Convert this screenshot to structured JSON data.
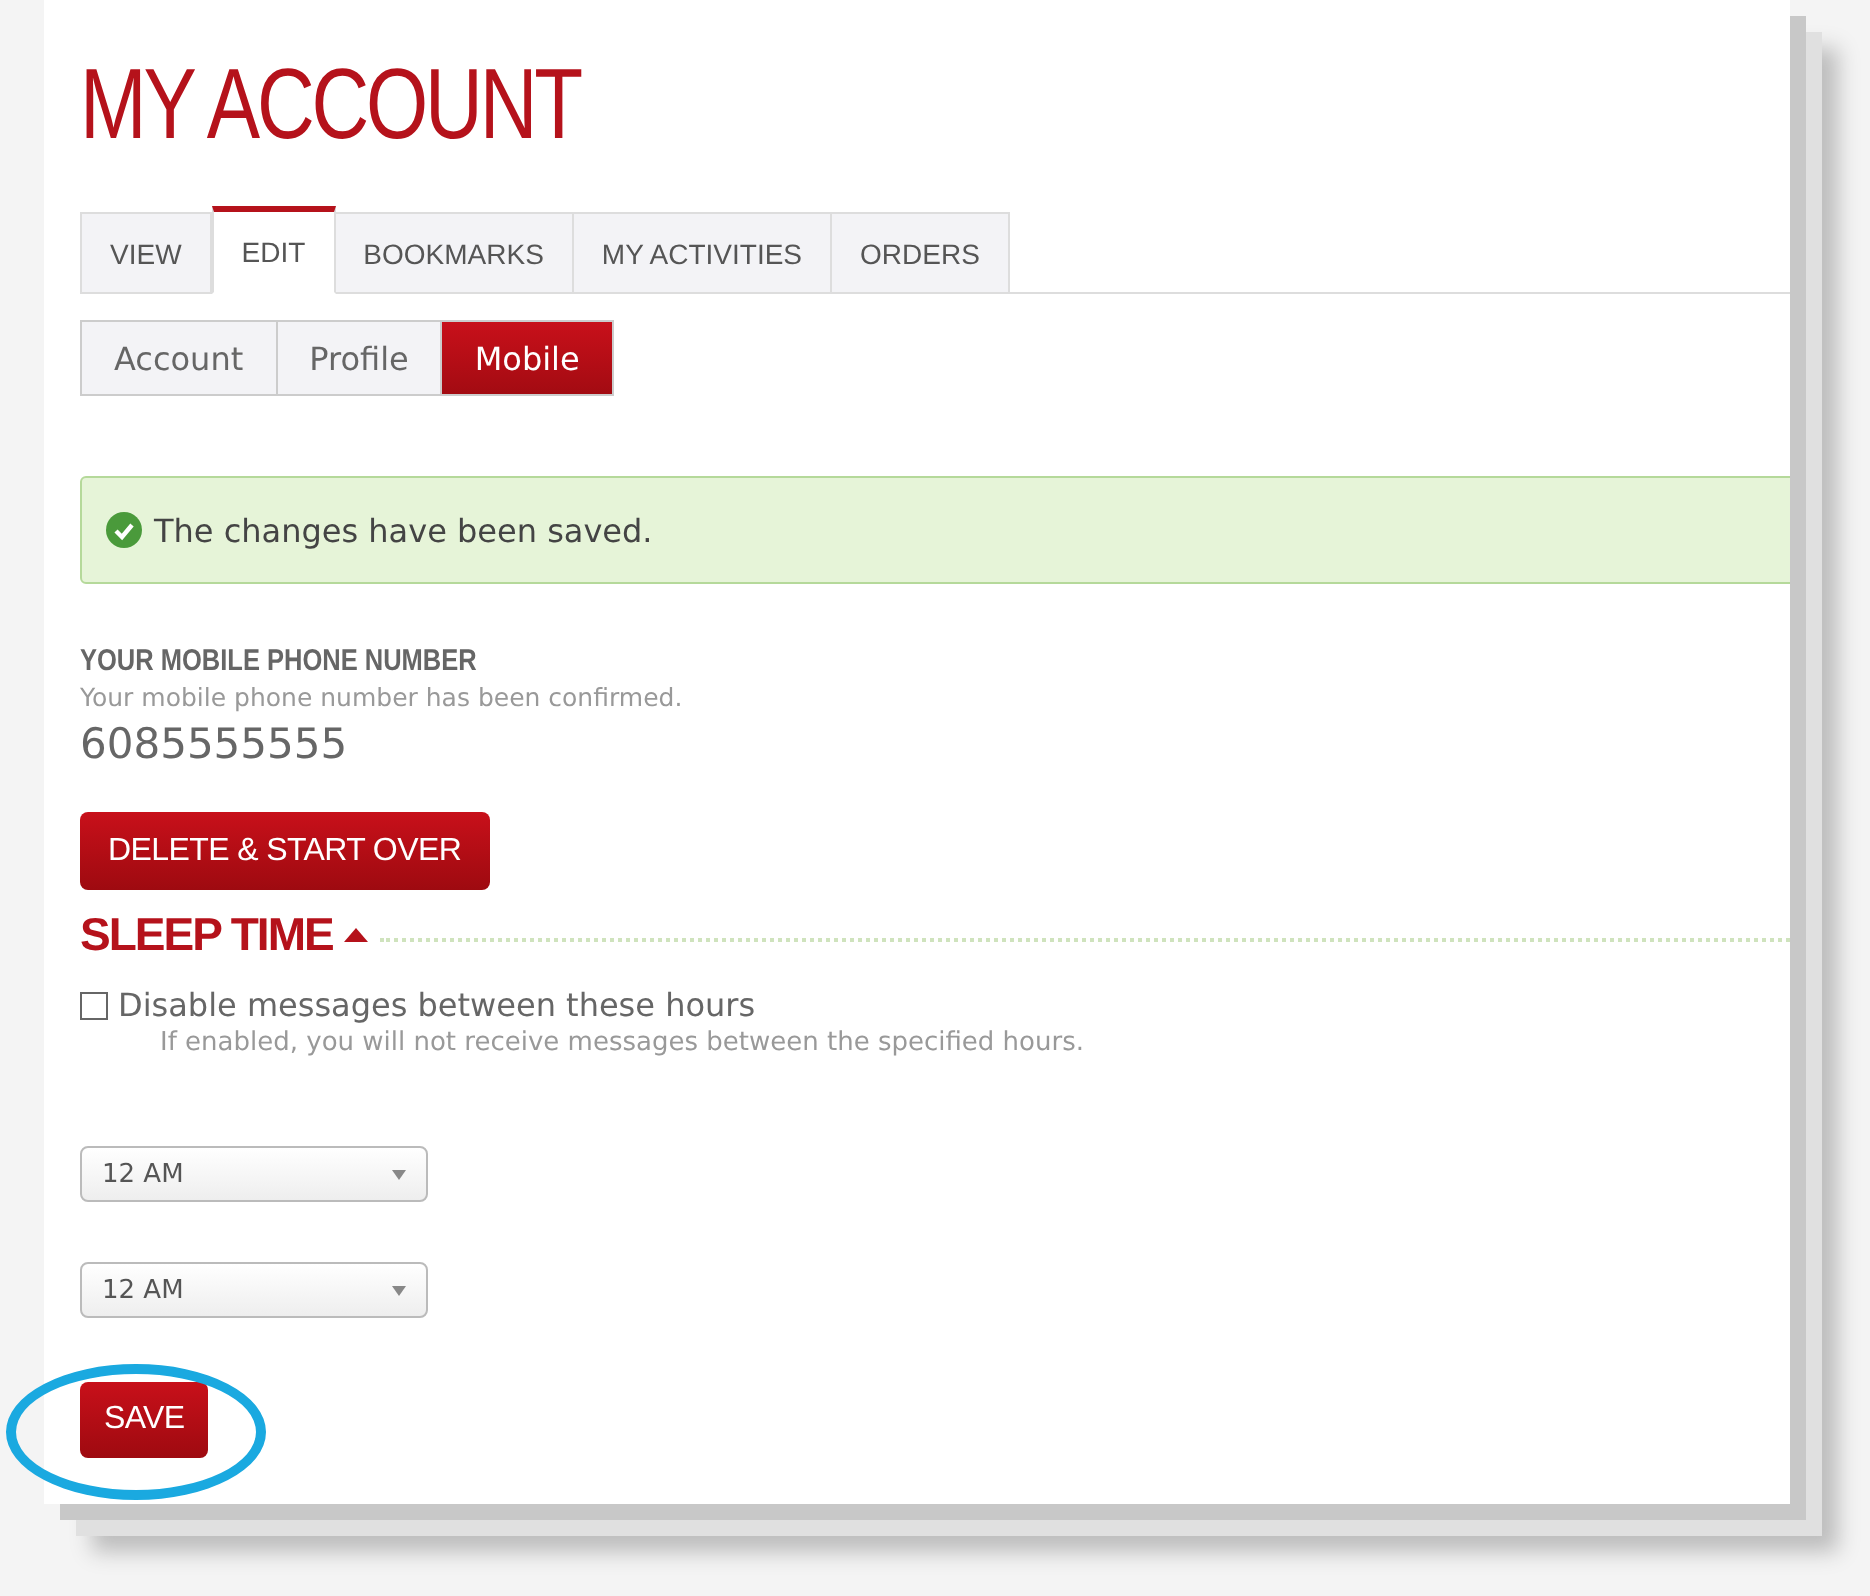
{
  "title": "MY ACCOUNT",
  "tabs": [
    {
      "label": "VIEW",
      "selected": false
    },
    {
      "label": "EDIT",
      "selected": true
    },
    {
      "label": "BOOKMARKS",
      "selected": false
    },
    {
      "label": "MY ACTIVITIES",
      "selected": false
    },
    {
      "label": "ORDERS",
      "selected": false
    }
  ],
  "subtabs": [
    {
      "label": "Account",
      "selected": false
    },
    {
      "label": "Profile",
      "selected": false
    },
    {
      "label": "Mobile",
      "selected": true
    }
  ],
  "alert": {
    "text": "The changes have been saved."
  },
  "phone": {
    "heading": "YOUR MOBILE PHONE NUMBER",
    "note": "Your mobile phone number has been confirmed.",
    "number": "6085555555"
  },
  "delete_button": "DELETE & START OVER",
  "sleep_time": {
    "heading": "SLEEP TIME",
    "expanded": true
  },
  "disable_option": {
    "label": "Disable messages between these hours",
    "checked": false,
    "hint": "If enabled, you will not receive messages between the specified hours."
  },
  "selects": [
    {
      "value": "12 AM"
    },
    {
      "value": "12 AM"
    }
  ],
  "save_button": {
    "label": "SAVE",
    "highlighted": true
  }
}
